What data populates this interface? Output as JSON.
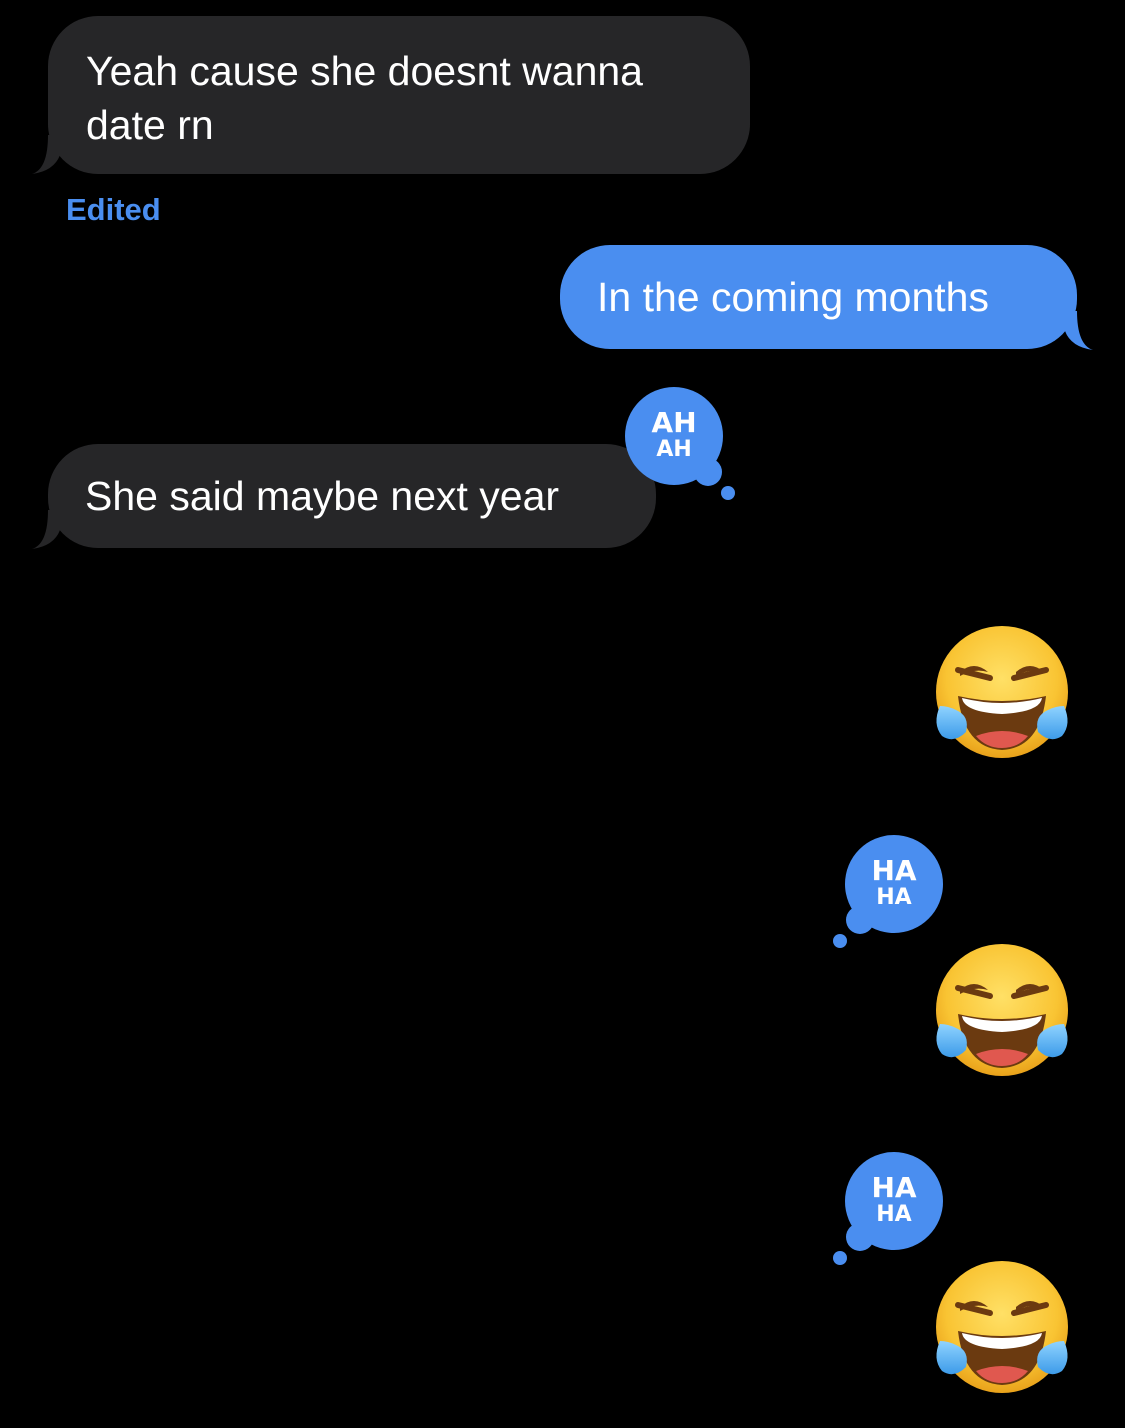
{
  "thread": {
    "messages": [
      {
        "id": "msg1",
        "direction": "incoming",
        "text_line1": "Yeah cause she doesnt wanna",
        "text_line2": "date rn",
        "status": "Edited"
      },
      {
        "id": "msg2",
        "direction": "outgoing",
        "text": "In the coming months"
      },
      {
        "id": "msg3",
        "direction": "incoming",
        "text": "She said maybe next year",
        "reaction": "haha"
      },
      {
        "id": "msg4",
        "direction": "outgoing",
        "emoji": "face-with-tears-of-joy"
      },
      {
        "id": "msg5",
        "direction": "outgoing",
        "emoji": "face-with-tears-of-joy",
        "reaction": "haha"
      },
      {
        "id": "msg6",
        "direction": "outgoing",
        "emoji": "face-with-tears-of-joy",
        "reaction": "haha"
      }
    ],
    "reaction_label": "HA HA"
  },
  "colors": {
    "background": "#000000",
    "incoming_bubble": "#262628",
    "outgoing_bubble": "#4A8EF0",
    "accent": "#4A8EF0",
    "text": "#FFFFFF"
  },
  "icons": {
    "reaction": "haha-reaction-icon",
    "emoji": "face-with-tears-of-joy-icon"
  }
}
